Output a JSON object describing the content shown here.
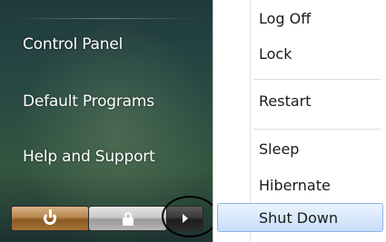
{
  "left_menu": {
    "items": [
      {
        "label": "Control Panel"
      },
      {
        "label": "Default Programs"
      },
      {
        "label": "Help and Support"
      }
    ]
  },
  "power_buttons": {
    "power_icon": "power-icon",
    "lock_icon": "lock-icon",
    "arrow_icon": "arrow-right-icon"
  },
  "flyout": {
    "items": [
      {
        "label": "Log Off"
      },
      {
        "label": "Lock"
      },
      {
        "label": "Restart"
      },
      {
        "label": "Sleep"
      },
      {
        "label": "Hibernate"
      },
      {
        "label": "Shut Down",
        "highlighted": true
      }
    ]
  },
  "colors": {
    "highlight_bg": "#d9e9fb",
    "highlight_border": "#8db2e3",
    "power_button": "#b8864e"
  }
}
